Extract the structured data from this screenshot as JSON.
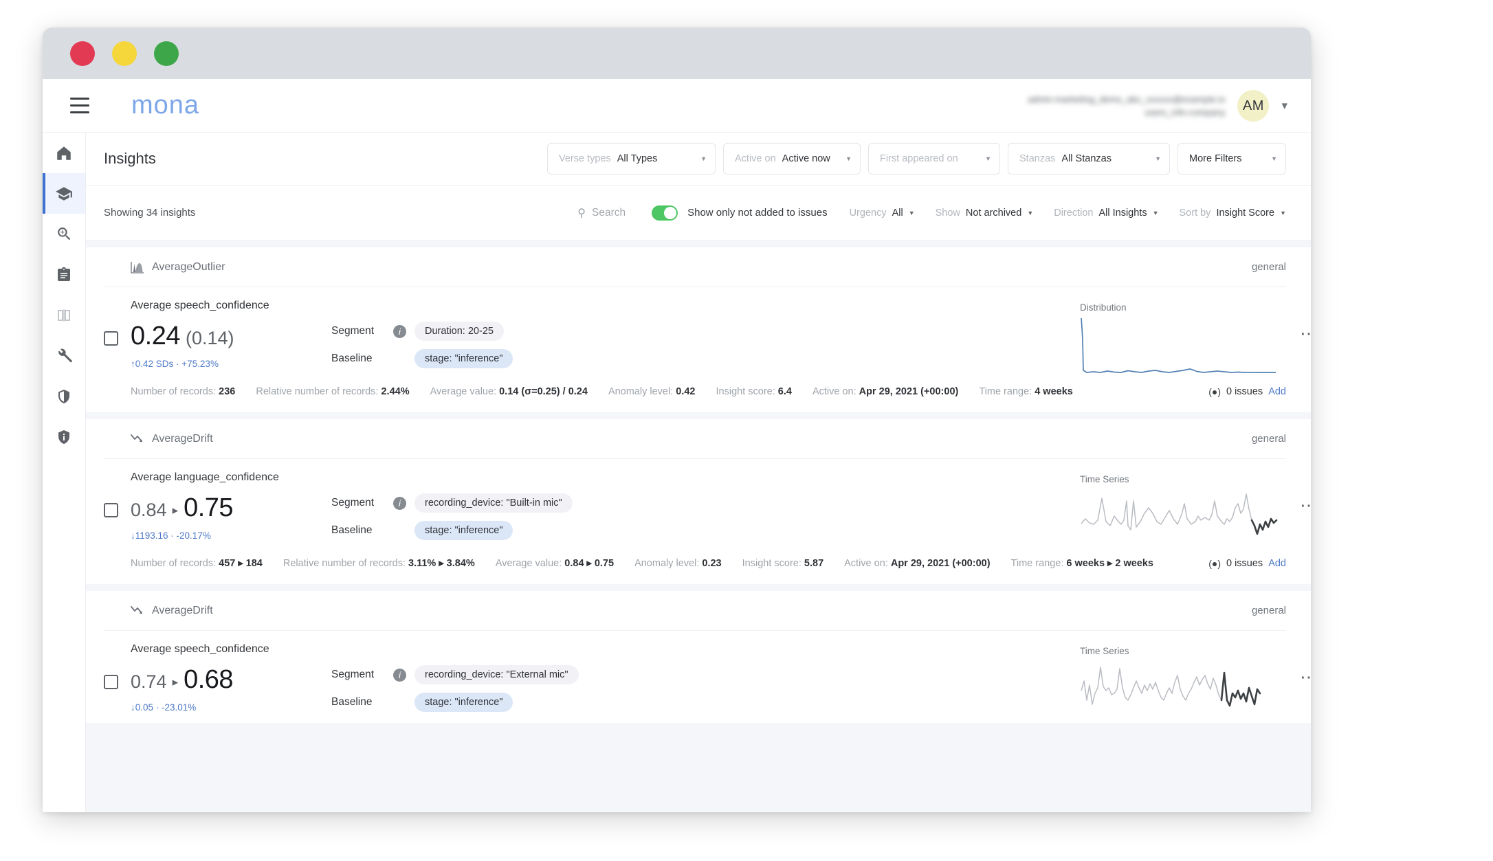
{
  "window": {
    "traffic_lights": [
      "close",
      "minimize",
      "maximize"
    ]
  },
  "appbar": {
    "menu_icon": "hamburger-menu-icon",
    "logo_text": "mona",
    "user_name_line1": "admin-marketing_demo_abc_xxxxxx@example.io",
    "user_name_line2": "users_info-company",
    "avatar_initials": "AM",
    "chevron_icon": "chevron-down-icon"
  },
  "sidebar": {
    "items": [
      {
        "name": "home",
        "icon": "home-icon",
        "active": false,
        "dim": false
      },
      {
        "name": "insights",
        "icon": "graduation-cap-icon",
        "active": true,
        "dim": false
      },
      {
        "name": "investigation",
        "icon": "zoom-in-icon",
        "active": false,
        "dim": false
      },
      {
        "name": "reports",
        "icon": "clipboard-icon",
        "active": false,
        "dim": false
      },
      {
        "name": "compare",
        "icon": "compare-icon",
        "active": false,
        "dim": true
      },
      {
        "name": "configuration",
        "icon": "wrench-icon",
        "active": false,
        "dim": false
      },
      {
        "name": "security",
        "icon": "shield-icon",
        "active": false,
        "dim": false
      },
      {
        "name": "about",
        "icon": "shield-info-icon",
        "active": false,
        "dim": false
      }
    ]
  },
  "header": {
    "page_title": "Insights"
  },
  "filters": [
    {
      "label": "Verse types",
      "value": "All Types",
      "width_class": "fb-w1"
    },
    {
      "label": "Active on",
      "value": "Active now",
      "width_class": "fb-w2"
    },
    {
      "label": "First appeared on",
      "value": "",
      "width_class": "fb-w3"
    },
    {
      "label": "Stanzas",
      "value": "All Stanzas",
      "width_class": "fb-w4"
    },
    {
      "label": "",
      "value": "More Filters",
      "width_class": "fb-w5"
    }
  ],
  "toolbar": {
    "showing_count": "Showing 34 insights",
    "search_icon": "search-icon",
    "search_placeholder": "Search",
    "toggle_label": "Show only not added to issues",
    "toggle_on": true,
    "toggle_color": "#4cc764",
    "selects": [
      {
        "key": "Urgency",
        "value": "All"
      },
      {
        "key": "Show",
        "value": "Not archived"
      },
      {
        "key": "Direction",
        "value": "All Insights"
      },
      {
        "key": "Sort by",
        "value": "Insight Score"
      }
    ]
  },
  "insights": [
    {
      "type_icon": "histogram-icon",
      "type_name": "AverageOutlier",
      "tag": "general",
      "metric_title": "Average speech_confidence",
      "value_primary": "0.24",
      "value_secondary": "(0.14)",
      "value_style": "paren",
      "delta_arrow": "↑",
      "delta_text": "0.42 SDs · +75.23%",
      "delta_color": "#4d79c7",
      "segment_key": "Segment",
      "segment_chip": "Duration: 20-25",
      "baseline_key": "Baseline",
      "baseline_chip": "stage: \"inference\"",
      "chart_caption": "Distribution",
      "chart_kind": "distribution",
      "kebab_icon": "more-options-icon",
      "stats": [
        {
          "label": "Number of records:",
          "value": "236"
        },
        {
          "label": "Relative number of records:",
          "value": "2.44%"
        },
        {
          "label": "Average value:",
          "value": "0.14 (σ=0.25) / 0.24"
        },
        {
          "label": "Anomaly level:",
          "value": "0.42"
        },
        {
          "label": "Insight score:",
          "value": "6.4"
        },
        {
          "label": "Active on:",
          "value": "Apr 29, 2021 (+00:00)"
        },
        {
          "label": "Time range:",
          "value": "4 weeks"
        }
      ],
      "issues_text": "0 issues",
      "add_label": "Add"
    },
    {
      "type_icon": "trend-down-icon",
      "type_name": "AverageDrift",
      "tag": "general",
      "metric_title": "Average language_confidence",
      "value_primary": "0.75",
      "value_secondary": "0.84",
      "value_style": "arrow",
      "delta_arrow": "↓",
      "delta_text": "1193.16 · -20.17%",
      "delta_color": "#4d79c7",
      "segment_key": "Segment",
      "segment_chip": "recording_device: \"Built-in mic\"",
      "baseline_key": "Baseline",
      "baseline_chip": "stage: \"inference\"",
      "chart_caption": "Time Series",
      "chart_kind": "timeseries",
      "kebab_icon": "more-options-icon",
      "stats": [
        {
          "label": "Number of records:",
          "value": "457 ▸ 184"
        },
        {
          "label": "Relative number of records:",
          "value": "3.11% ▸ 3.84%"
        },
        {
          "label": "Average value:",
          "value": "0.84 ▸ 0.75"
        },
        {
          "label": "Anomaly level:",
          "value": "0.23"
        },
        {
          "label": "Insight score:",
          "value": "5.87"
        },
        {
          "label": "Active on:",
          "value": "Apr 29, 2021 (+00:00)"
        },
        {
          "label": "Time range:",
          "value": "6 weeks ▸ 2 weeks"
        }
      ],
      "issues_text": "0 issues",
      "add_label": "Add"
    },
    {
      "type_icon": "trend-down-icon",
      "type_name": "AverageDrift",
      "tag": "general",
      "metric_title": "Average speech_confidence",
      "value_primary": "0.68",
      "value_secondary": "0.74",
      "value_style": "arrow",
      "delta_arrow": "↓",
      "delta_text": "0.05 · -23.01%",
      "delta_color": "#4d79c7",
      "segment_key": "Segment",
      "segment_chip": "recording_device: \"External mic\"",
      "baseline_key": "Baseline",
      "baseline_chip": "stage: \"inference\"",
      "chart_caption": "Time Series",
      "chart_kind": "timeseries2",
      "kebab_icon": "more-options-icon",
      "stats": [],
      "issues_text": "",
      "add_label": ""
    }
  ]
}
